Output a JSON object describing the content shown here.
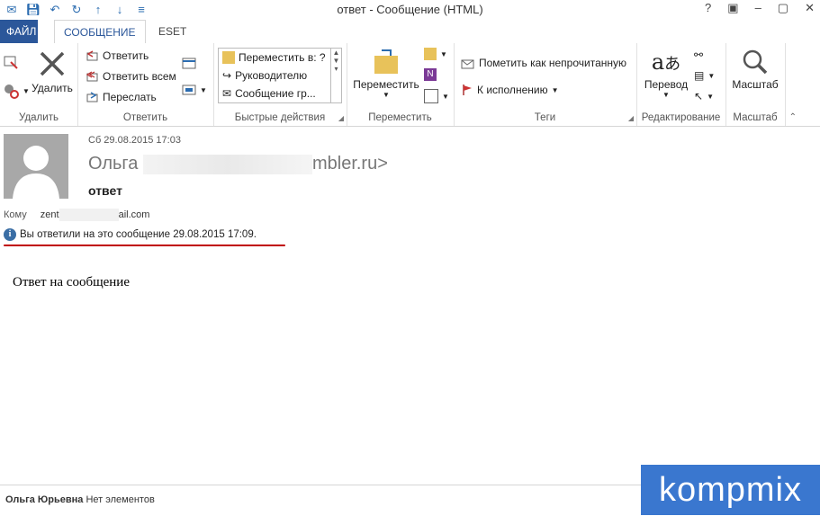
{
  "window": {
    "title": "ответ  - Сообщение (HTML)",
    "controls": [
      "?",
      "▣",
      "–",
      "▢",
      "✕"
    ]
  },
  "tabs": [
    {
      "label": "ФАЙЛ"
    },
    {
      "label": "СООБЩЕНИЕ"
    },
    {
      "label": "ESET"
    }
  ],
  "ribbon": {
    "delete_group": {
      "delete_label": "Удалить",
      "group_label": "Удалить"
    },
    "reply_group": {
      "reply": "Ответить",
      "reply_all": "Ответить всем",
      "forward": "Переслать",
      "group_label": "Ответить"
    },
    "quick_group": {
      "items": [
        "Переместить в: ?",
        "Руководителю",
        "Сообщение гр..."
      ],
      "group_label": "Быстрые действия"
    },
    "move_group": {
      "move_label": "Переместить",
      "group_label": "Переместить"
    },
    "tags_group": {
      "mark_unread": "Пометить как непрочитанную",
      "followup": "К исполнению",
      "group_label": "Теги"
    },
    "edit_group": {
      "translate": "Перевод",
      "group_label": "Редактирование"
    },
    "zoom_group": {
      "zoom": "Масштаб",
      "group_label": "Масштаб"
    }
  },
  "message": {
    "date": "Сб 29.08.2015 17:03",
    "from_name": "Ольга",
    "from_tail": "mbler.ru>",
    "subject": "ответ",
    "to_label": "Кому",
    "to_head": "zent",
    "to_tail": "ail.com",
    "info": "Вы ответили на это сообщение 29.08.2015 17:09.",
    "body": "Ответ на сообщение"
  },
  "status": {
    "person": "Ольга Юрьевна",
    "items": "Нет элементов"
  },
  "watermark": "kompmix",
  "colors": {
    "accent": "#2b579a",
    "underline": "#c00000"
  }
}
